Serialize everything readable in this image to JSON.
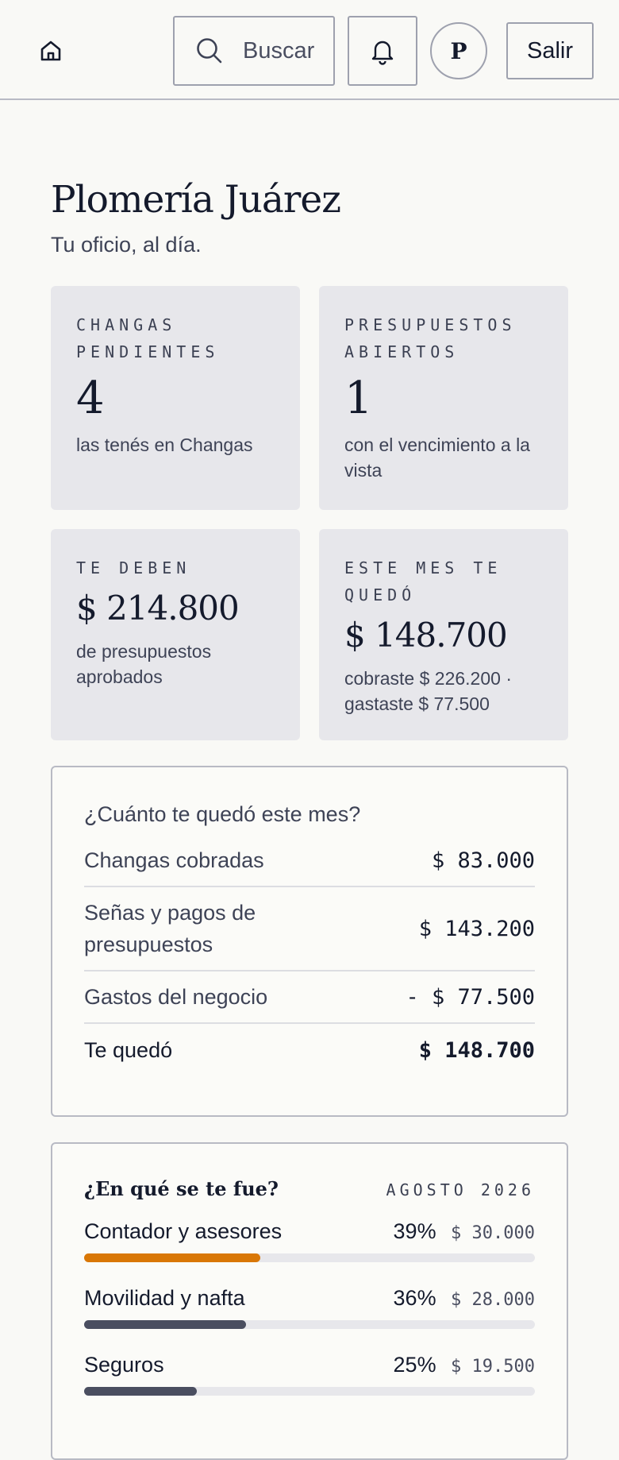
{
  "header": {
    "search_label": "Buscar",
    "avatar_initial": "P",
    "logout_label": "Salir"
  },
  "page": {
    "title": "Plomería Juárez",
    "subtitle": "Tu oficio, al día."
  },
  "stats": {
    "pending": {
      "label": "CHANGAS PENDIENTES",
      "value": "4",
      "desc": "las tenés en Changas"
    },
    "quotes": {
      "label": "PRESUPUESTOS ABIERTOS",
      "value": "1",
      "desc": "con el vencimiento a la vista"
    },
    "owed": {
      "label": "TE DEBEN",
      "value": "$ 214.800",
      "desc": "de presupuestos aprobados"
    },
    "month": {
      "label": "ESTE MES TE QUEDÓ",
      "value": "$ 148.700",
      "desc": "cobraste $ 226.200 · gastaste $ 77.500"
    }
  },
  "summary": {
    "title": "¿Cuánto te quedó este mes?",
    "rows": [
      {
        "label": "Changas cobradas",
        "value": "$ 83.000"
      },
      {
        "label": "Señas y pagos de presupuestos",
        "value": "$ 143.200"
      },
      {
        "label": "Gastos del negocio",
        "value": "- $ 77.500"
      }
    ],
    "total": {
      "label": "Te quedó",
      "value": "$ 148.700"
    }
  },
  "expenses": {
    "title": "¿En qué se te fue?",
    "month": "AGOSTO 2026",
    "items": [
      {
        "name": "Contador y asesores",
        "percent_label": "39%",
        "amount": "$ 30.000",
        "fill": 0.39,
        "color": "#d97706"
      },
      {
        "name": "Movilidad y nafta",
        "percent_label": "36%",
        "amount": "$ 28.000",
        "fill": 0.36,
        "color": "#4a4e60"
      },
      {
        "name": "Seguros",
        "percent_label": "25%",
        "amount": "$ 19.500",
        "fill": 0.25,
        "color": "#4a4e60"
      }
    ]
  },
  "icons": {
    "home": "home-icon",
    "search": "search-icon",
    "bell": "bell-icon"
  },
  "colors": {
    "background": "#f9f9f6",
    "card": "#e7e7eb",
    "accent": "#d97706",
    "text": "#141a2c"
  }
}
